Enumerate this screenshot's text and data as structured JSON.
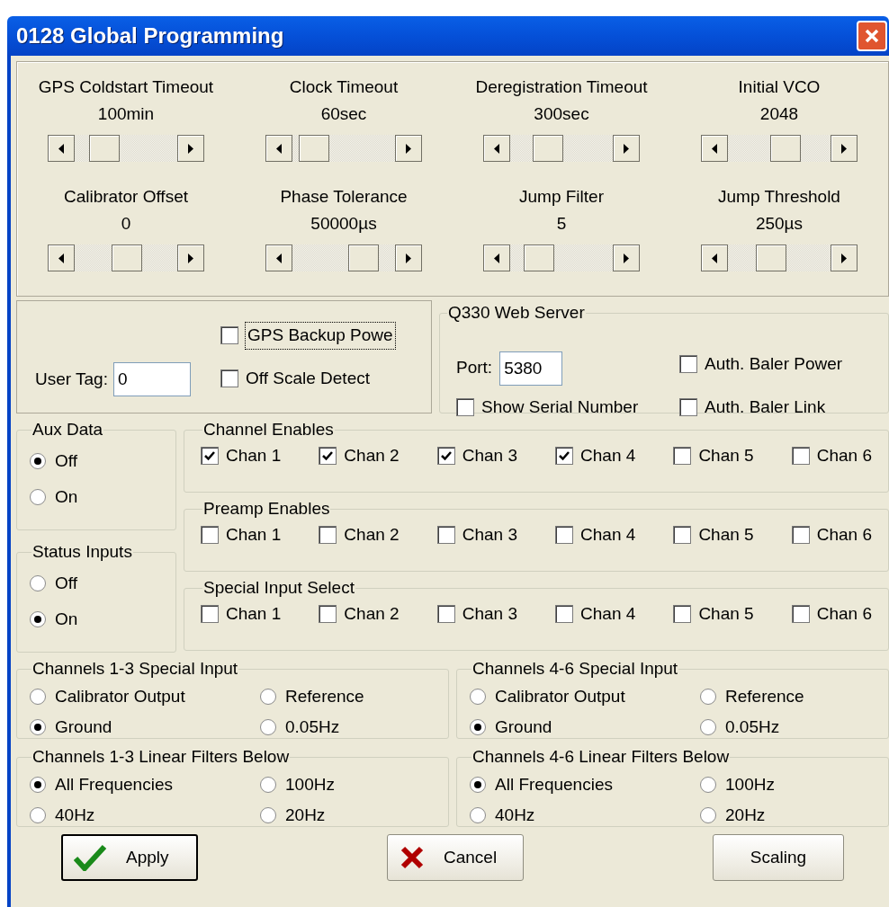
{
  "window": {
    "title": "0128 Global Programming"
  },
  "sliders": [
    {
      "label": "GPS Coldstart Timeout",
      "value": "100min",
      "level": 0.2
    },
    {
      "label": "Clock Timeout",
      "value": "60sec",
      "level": 0.08
    },
    {
      "label": "Deregistration Timeout",
      "value": "300sec",
      "level": 0.3
    },
    {
      "label": "Initial VCO",
      "value": "2048",
      "level": 0.57
    },
    {
      "label": "Calibrator Offset",
      "value": "0",
      "level": 0.5
    },
    {
      "label": "Phase Tolerance",
      "value": "50000µs",
      "level": 0.76
    },
    {
      "label": "Jump Filter",
      "value": "5",
      "level": 0.18
    },
    {
      "label": "Jump Threshold",
      "value": "250µs",
      "level": 0.38
    }
  ],
  "gps_backup_power": {
    "label": "GPS Backup Powe",
    "checked": false,
    "focused": true
  },
  "user_tag": {
    "label": "User Tag:",
    "value": "0"
  },
  "off_scale_detect": {
    "label": "Off Scale Detect",
    "checked": false
  },
  "web_server": {
    "title": "Q330 Web Server",
    "port_label": "Port:",
    "port": "5380",
    "auth_baler_power": {
      "label": "Auth. Baler Power",
      "checked": false
    },
    "show_serial_number": {
      "label": "Show Serial Number",
      "checked": false
    },
    "auth_baler_link": {
      "label": "Auth. Baler Link",
      "checked": false
    }
  },
  "aux_data": {
    "title": "Aux Data",
    "options": [
      {
        "label": "Off",
        "selected": true
      },
      {
        "label": "On",
        "selected": false
      }
    ]
  },
  "status_inputs": {
    "title": "Status Inputs",
    "options": [
      {
        "label": "Off",
        "selected": false
      },
      {
        "label": "On",
        "selected": true
      }
    ]
  },
  "channel_groups": [
    {
      "title": "Channel Enables",
      "channels": [
        {
          "label": "Chan 1",
          "checked": true
        },
        {
          "label": "Chan 2",
          "checked": true
        },
        {
          "label": "Chan 3",
          "checked": true
        },
        {
          "label": "Chan 4",
          "checked": true
        },
        {
          "label": "Chan 5",
          "checked": false
        },
        {
          "label": "Chan 6",
          "checked": false
        }
      ]
    },
    {
      "title": "Preamp Enables",
      "channels": [
        {
          "label": "Chan 1",
          "checked": false
        },
        {
          "label": "Chan 2",
          "checked": false
        },
        {
          "label": "Chan 3",
          "checked": false
        },
        {
          "label": "Chan 4",
          "checked": false
        },
        {
          "label": "Chan 5",
          "checked": false
        },
        {
          "label": "Chan 6",
          "checked": false
        }
      ]
    },
    {
      "title": "Special Input Select",
      "channels": [
        {
          "label": "Chan 1",
          "checked": false
        },
        {
          "label": "Chan 2",
          "checked": false
        },
        {
          "label": "Chan 3",
          "checked": false
        },
        {
          "label": "Chan 4",
          "checked": false
        },
        {
          "label": "Chan 5",
          "checked": false
        },
        {
          "label": "Chan 6",
          "checked": false
        }
      ]
    }
  ],
  "option_groups": [
    {
      "title": "Channels 1-3 Special Input",
      "options": [
        {
          "label": "Calibrator Output",
          "selected": false
        },
        {
          "label": "Reference",
          "selected": false
        },
        {
          "label": "Ground",
          "selected": true
        },
        {
          "label": "0.05Hz",
          "selected": false
        }
      ]
    },
    {
      "title": "Channels 4-6 Special Input",
      "options": [
        {
          "label": "Calibrator Output",
          "selected": false
        },
        {
          "label": "Reference",
          "selected": false
        },
        {
          "label": "Ground",
          "selected": true
        },
        {
          "label": "0.05Hz",
          "selected": false
        }
      ]
    },
    {
      "title": "Channels 1-3 Linear Filters Below",
      "options": [
        {
          "label": "All Frequencies",
          "selected": true
        },
        {
          "label": "100Hz",
          "selected": false
        },
        {
          "label": "40Hz",
          "selected": false
        },
        {
          "label": "20Hz",
          "selected": false
        }
      ]
    },
    {
      "title": "Channels 4-6 Linear Filters Below",
      "options": [
        {
          "label": "All Frequencies",
          "selected": true
        },
        {
          "label": "100Hz",
          "selected": false
        },
        {
          "label": "40Hz",
          "selected": false
        },
        {
          "label": "20Hz",
          "selected": false
        }
      ]
    }
  ],
  "buttons": [
    {
      "label": "Apply",
      "kind": "apply",
      "default": true
    },
    {
      "label": "Cancel",
      "kind": "cancel",
      "default": false
    },
    {
      "label": "Scaling",
      "kind": "plain",
      "default": false
    }
  ]
}
